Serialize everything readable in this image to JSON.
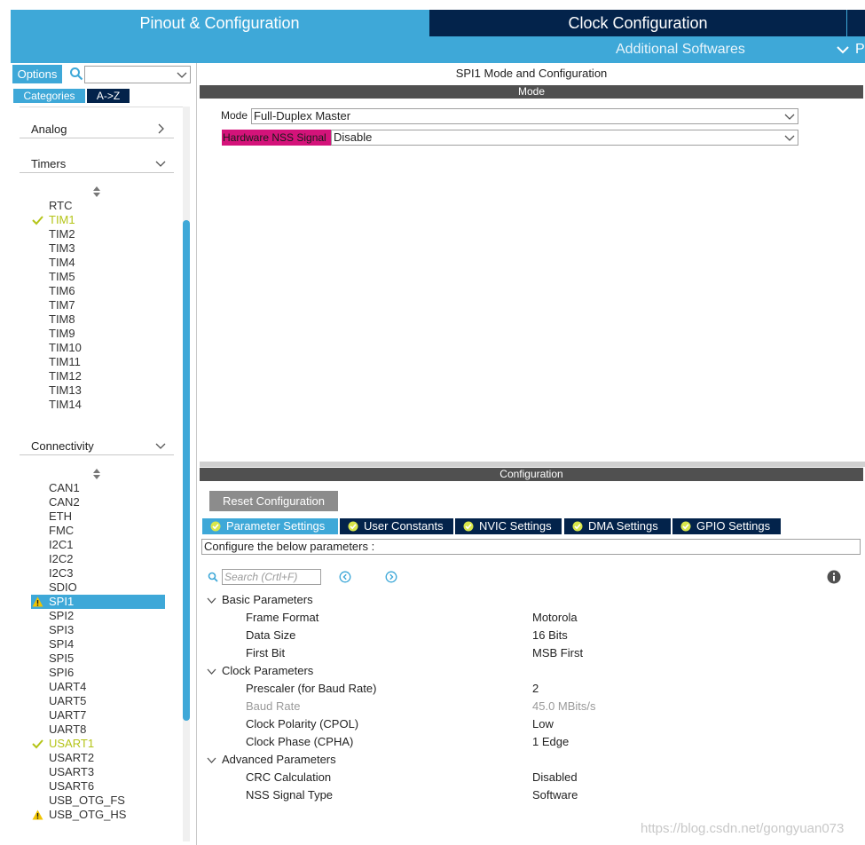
{
  "top_tabs": {
    "pinout": "Pinout & Configuration",
    "clock": "Clock Configuration",
    "additional": "Additional Softwares",
    "extra": "P"
  },
  "left": {
    "options": "Options",
    "categories": "Categories",
    "az": "A->Z",
    "analog": "Analog",
    "timers": "Timers",
    "connectivity": "Connectivity",
    "timer_items": [
      "RTC",
      "TIM1",
      "TIM2",
      "TIM3",
      "TIM4",
      "TIM5",
      "TIM6",
      "TIM7",
      "TIM8",
      "TIM9",
      "TIM10",
      "TIM11",
      "TIM12",
      "TIM13",
      "TIM14"
    ],
    "conn_items": [
      "CAN1",
      "CAN2",
      "ETH",
      "FMC",
      "I2C1",
      "I2C2",
      "I2C3",
      "SDIO",
      "SPI1",
      "SPI2",
      "SPI3",
      "SPI4",
      "SPI5",
      "SPI6",
      "UART4",
      "UART5",
      "UART7",
      "UART8",
      "USART1",
      "USART2",
      "USART3",
      "USART6",
      "USB_OTG_FS",
      "USB_OTG_HS"
    ]
  },
  "mode": {
    "title": "SPI1 Mode and Configuration",
    "bar": "Mode",
    "mode_label": "Mode",
    "mode_value": "Full-Duplex Master",
    "nss_label": "Hardware NSS Signal",
    "nss_value": "Disable"
  },
  "config": {
    "bar": "Configuration",
    "reset": "Reset Configuration",
    "tabs": [
      "Parameter Settings",
      "User Constants",
      "NVIC Settings",
      "DMA Settings",
      "GPIO Settings"
    ],
    "configure_text": "Configure the below parameters :",
    "search_placeholder": "Search (Crtl+F)",
    "groups": {
      "basic": "Basic Parameters",
      "clock": "Clock Parameters",
      "advanced": "Advanced Parameters"
    },
    "params": {
      "frame_format": {
        "name": "Frame Format",
        "value": "Motorola"
      },
      "data_size": {
        "name": "Data Size",
        "value": "16 Bits"
      },
      "first_bit": {
        "name": "First Bit",
        "value": "MSB First"
      },
      "prescaler": {
        "name": "Prescaler (for Baud Rate)",
        "value": "2"
      },
      "baud_rate": {
        "name": "Baud Rate",
        "value": "45.0 MBits/s"
      },
      "cpol": {
        "name": "Clock Polarity (CPOL)",
        "value": "Low"
      },
      "cpha": {
        "name": "Clock Phase (CPHA)",
        "value": "1 Edge"
      },
      "crc": {
        "name": "CRC Calculation",
        "value": "Disabled"
      },
      "nss_type": {
        "name": "NSS Signal Type",
        "value": "Software"
      }
    }
  },
  "watermark": "https://blog.csdn.net/gongyuan073",
  "colors": {
    "accent": "#3ea8d8",
    "dark": "#03234b",
    "ok": "#b4c417",
    "warn": "#f2c500",
    "nss_highlight": "#d4137a"
  }
}
